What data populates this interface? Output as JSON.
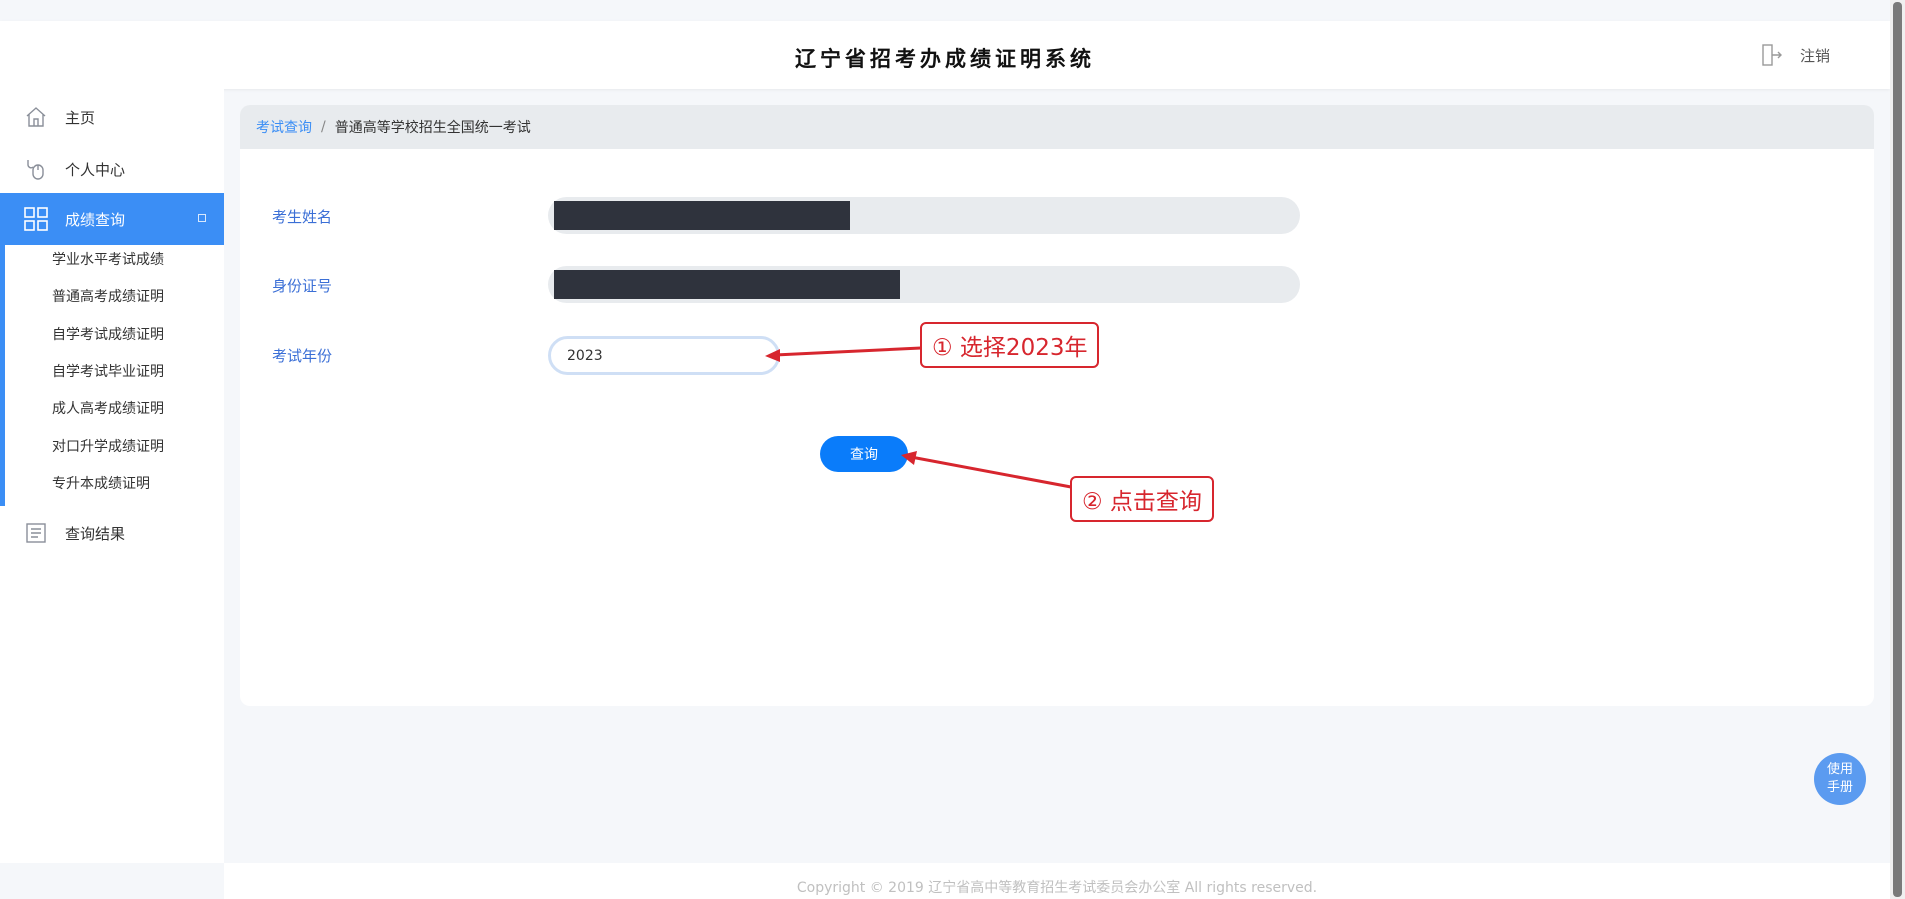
{
  "header": {
    "title": "辽宁省招考办成绩证明系统",
    "logout_label": "注销"
  },
  "sidebar": {
    "items": [
      {
        "label": "主页"
      },
      {
        "label": "个人中心"
      },
      {
        "label": "成绩查询"
      },
      {
        "label": "查询结果"
      }
    ],
    "subitems": [
      {
        "label": "学业水平考试成绩"
      },
      {
        "label": "普通高考成绩证明"
      },
      {
        "label": "自学考试成绩证明"
      },
      {
        "label": "自学考试毕业证明"
      },
      {
        "label": "成人高考成绩证明"
      },
      {
        "label": "对口升学成绩证明"
      },
      {
        "label": "专升本成绩证明"
      }
    ]
  },
  "breadcrumb": {
    "link": "考试查询",
    "separator": "/",
    "current": "普通高等学校招生全国统一考试"
  },
  "form": {
    "name_label": "考生姓名",
    "id_label": "身份证号",
    "year_label": "考试年份",
    "year_value": "2023",
    "query_button": "查询"
  },
  "annotations": {
    "step1": "① 选择2023年",
    "step2": "② 点击查询"
  },
  "manual_button": {
    "line1": "使用",
    "line2": "手册"
  },
  "footer": {
    "copyright": "Copyright © 2019 辽宁省高中等教育招生考试委员会办公室 All rights reserved."
  },
  "colors": {
    "accent": "#3b8ef5",
    "button": "#0a7cfa",
    "annotation": "#d7262e"
  },
  "icons": [
    "home-icon",
    "mouse-icon",
    "grid-icon",
    "document-icon",
    "logout-door-icon"
  ]
}
